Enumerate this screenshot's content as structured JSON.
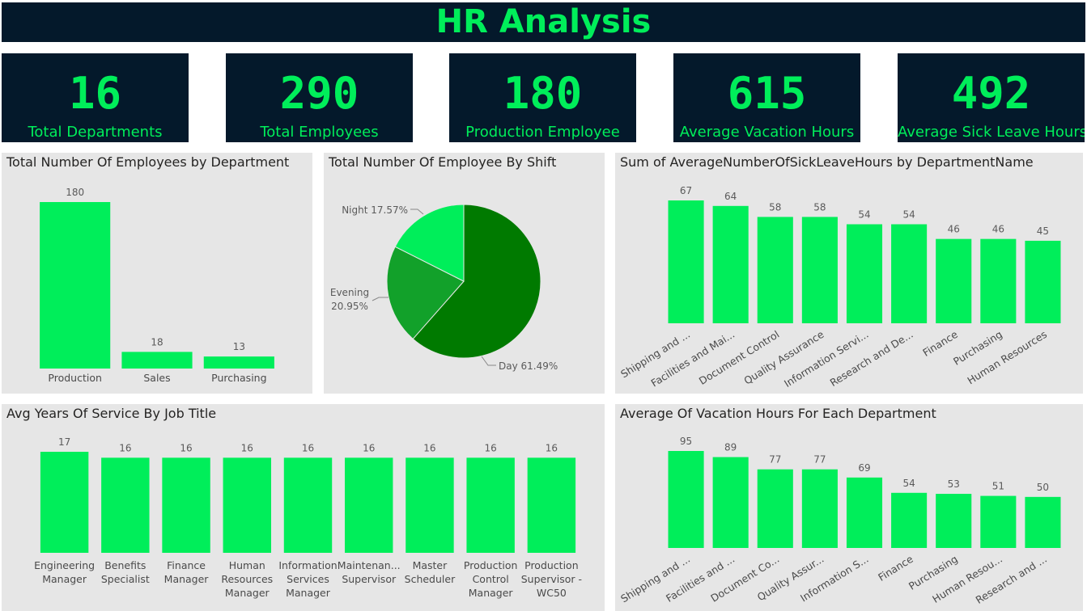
{
  "header": {
    "title": "HR Analysis"
  },
  "kpis": [
    {
      "value": "16",
      "label": "Total Departments"
    },
    {
      "value": "290",
      "label": "Total Employees"
    },
    {
      "value": "180",
      "label": "Production Employee"
    },
    {
      "value": "615",
      "label": "Average Vacation Hours"
    },
    {
      "value": "492",
      "label": "Average Sick Leave Hours"
    }
  ],
  "colors": {
    "accent": "#00ee5a",
    "dark": "#04192b",
    "panel": "#e6e6e6",
    "pie_day": "#007a00",
    "pie_evening": "#12a12a",
    "pie_night": "#00ee5a"
  },
  "chart_data": [
    {
      "type": "bar",
      "title": "Total Number Of Employees by Department",
      "categories": [
        "Production",
        "Sales",
        "Purchasing"
      ],
      "values": [
        180,
        18,
        13
      ],
      "ylim": [
        0,
        180
      ],
      "grid": false
    },
    {
      "type": "pie",
      "title": "Total Number Of Employee By Shift",
      "slices": [
        {
          "name": "Day",
          "value": 61.49,
          "label": "Day 61.49%"
        },
        {
          "name": "Evening",
          "value": 20.95,
          "label_lines": [
            "Evening",
            "20.95%"
          ]
        },
        {
          "name": "Night",
          "value": 17.57,
          "label": "Night 17.57%"
        }
      ]
    },
    {
      "type": "bar",
      "title": "Sum of AverageNumberOfSickLeaveHours by DepartmentName",
      "categories": [
        "Shipping and ...",
        "Facilities and Mai...",
        "Document Control",
        "Quality Assurance",
        "Information Servi...",
        "Research and De...",
        "Finance",
        "Purchasing",
        "Human Resources"
      ],
      "values": [
        67,
        64,
        58,
        58,
        54,
        54,
        46,
        46,
        45
      ],
      "ylim": [
        0,
        67
      ],
      "grid": false
    },
    {
      "type": "bar",
      "title": "Avg Years Of Service By Job Title",
      "categories": [
        [
          "Engineering",
          "Manager"
        ],
        [
          "Benefits",
          "Specialist"
        ],
        [
          "Finance",
          "Manager"
        ],
        [
          "Human",
          "Resources",
          "Manager"
        ],
        [
          "Information",
          "Services",
          "Manager"
        ],
        [
          "Maintenan...",
          "Supervisor"
        ],
        [
          "Master",
          "Scheduler"
        ],
        [
          "Production",
          "Control",
          "Manager"
        ],
        [
          "Production",
          "Supervisor -",
          "WC50"
        ]
      ],
      "values": [
        17,
        16,
        16,
        16,
        16,
        16,
        16,
        16,
        16
      ],
      "ylim": [
        0,
        17
      ],
      "grid": false
    },
    {
      "type": "bar",
      "title": "Average Of Vacation Hours For Each Department",
      "categories": [
        "Shipping and ...",
        "Facilities and ...",
        "Document Co...",
        "Quality Assur...",
        "Information S...",
        "Finance",
        "Purchasing",
        "Human Resou...",
        "Research and ..."
      ],
      "values": [
        95,
        89,
        77,
        77,
        69,
        54,
        53,
        51,
        50
      ],
      "ylim": [
        0,
        95
      ],
      "grid": false
    }
  ]
}
